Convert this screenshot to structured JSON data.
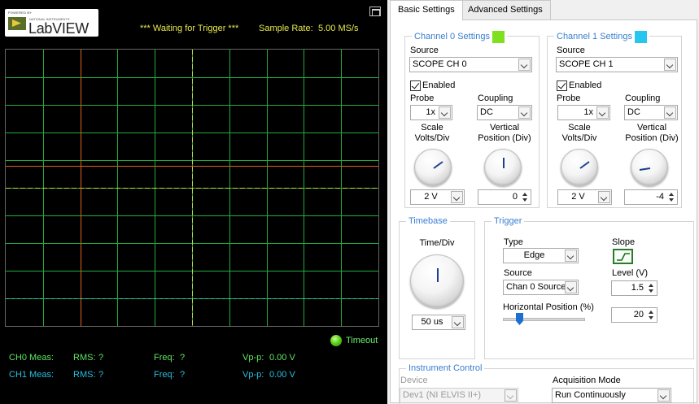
{
  "header": {
    "status": "*** Waiting for Trigger ***",
    "sample_rate_label": "Sample Rate:",
    "sample_rate_value": "5.00 MS/s",
    "logo_text": "LabVIEW",
    "logo_powered": "POWERED BY",
    "logo_ni": "NATIONAL INSTRUMENTS"
  },
  "graph": {
    "grid_color": "#1fae3a",
    "ch0_color": "#e06020",
    "ch1_color": "#c8d84a",
    "ch1_dashed_color": "#2fc6c6"
  },
  "timeout": {
    "label": "Timeout",
    "led_color": "#5ed21a"
  },
  "measurements": {
    "ch0": {
      "label": "CH0 Meas:",
      "rms_label": "RMS:",
      "rms_value": "?",
      "freq_label": "Freq:",
      "freq_value": "?",
      "vpp_label": "Vp-p:",
      "vpp_value": "0.00 V"
    },
    "ch1": {
      "label": "CH1 Meas:",
      "rms_label": "RMS:",
      "rms_value": "?",
      "freq_label": "Freq:",
      "freq_value": "?",
      "vpp_label": "Vp-p:",
      "vpp_value": "0.00 V"
    }
  },
  "tabs": [
    {
      "label": "Basic Settings",
      "active": true
    },
    {
      "label": "Advanced Settings",
      "active": false
    }
  ],
  "channel0": {
    "title": "Channel 0 Settings",
    "color": "#7ee01e",
    "source_label": "Source",
    "source_value": "SCOPE CH 0",
    "enabled_label": "Enabled",
    "enabled": true,
    "probe_label": "Probe",
    "probe_value": "1x",
    "coupling_label": "Coupling",
    "coupling_value": "DC",
    "scale_label_1": "Scale",
    "scale_label_2": "Volts/Div",
    "scale_value": "2 V",
    "vpos_label_1": "Vertical",
    "vpos_label_2": "Position (Div)",
    "vpos_value": "0"
  },
  "channel1": {
    "title": "Channel 1 Settings",
    "color": "#27c6ee",
    "source_label": "Source",
    "source_value": "SCOPE CH 1",
    "enabled_label": "Enabled",
    "enabled": true,
    "probe_label": "Probe",
    "probe_value": "1x",
    "coupling_label": "Coupling",
    "coupling_value": "DC",
    "scale_label_1": "Scale",
    "scale_label_2": "Volts/Div",
    "scale_value": "2 V",
    "vpos_label_1": "Vertical",
    "vpos_label_2": "Position (Div)",
    "vpos_value": "-4"
  },
  "timebase": {
    "title": "Timebase",
    "label": "Time/Div",
    "value": "50 us"
  },
  "trigger": {
    "title": "Trigger",
    "type_label": "Type",
    "type_value": "Edge",
    "slope_label": "Slope",
    "source_label": "Source",
    "source_value": "Chan 0 Source",
    "level_label": "Level (V)",
    "level_value": "1.5",
    "hpos_label": "Horizontal Position (%)",
    "hpos_value": "20"
  },
  "instrument": {
    "title": "Instrument Control",
    "device_label": "Device",
    "device_value": "Dev1 (NI ELVIS II+)",
    "acq_label": "Acquisition Mode",
    "acq_value": "Run Continuously"
  }
}
